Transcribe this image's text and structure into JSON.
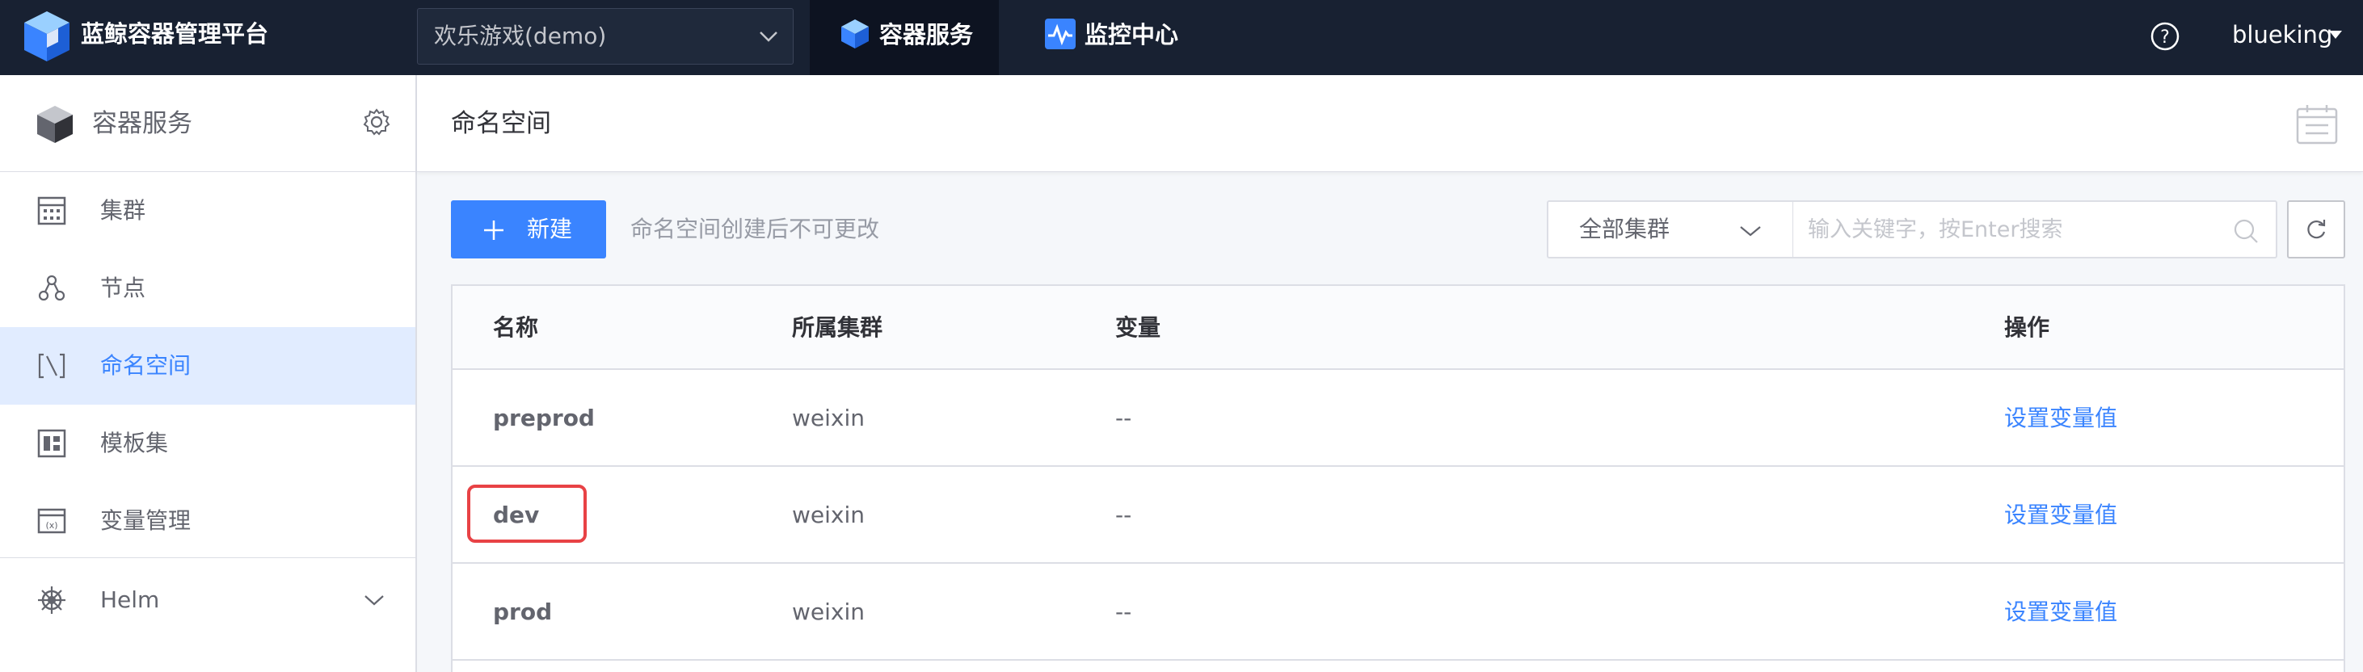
{
  "topbar": {
    "brand": "蓝鲸容器管理平台",
    "project_select": "欢乐游戏(demo)",
    "nav": [
      {
        "label": "容器服务",
        "active": true,
        "icon": "cube-icon"
      },
      {
        "label": "监控中心",
        "active": false,
        "icon": "monitor-icon"
      }
    ],
    "user": "blueking"
  },
  "sidebar": {
    "title": "容器服务",
    "items": [
      {
        "label": "集群",
        "icon": "cluster-icon"
      },
      {
        "label": "节点",
        "icon": "node-icon"
      },
      {
        "label": "命名空间",
        "icon": "namespace-icon",
        "active": true
      },
      {
        "label": "模板集",
        "icon": "template-icon"
      },
      {
        "label": "变量管理",
        "icon": "variable-icon"
      },
      {
        "label": "Helm",
        "icon": "helm-icon",
        "expandable": true
      }
    ]
  },
  "main": {
    "title": "命名空间",
    "new_button": "新建",
    "hint": "命名空间创建后不可更改",
    "cluster_select": "全部集群",
    "search_placeholder": "输入关键字，按Enter搜索",
    "table": {
      "headers": [
        "名称",
        "所属集群",
        "变量",
        "操作"
      ],
      "rows": [
        {
          "name": "preprod",
          "cluster": "weixin",
          "variables": "--",
          "action": "设置变量值"
        },
        {
          "name": "dev",
          "cluster": "weixin",
          "variables": "--",
          "action": "设置变量值",
          "highlighted": true
        },
        {
          "name": "prod",
          "cluster": "weixin",
          "variables": "--",
          "action": "设置变量值"
        }
      ]
    }
  },
  "colors": {
    "topbar": "#182132",
    "accent": "#3a84ff",
    "active_bg": "#e1ecff",
    "highlight": "#e84245"
  }
}
